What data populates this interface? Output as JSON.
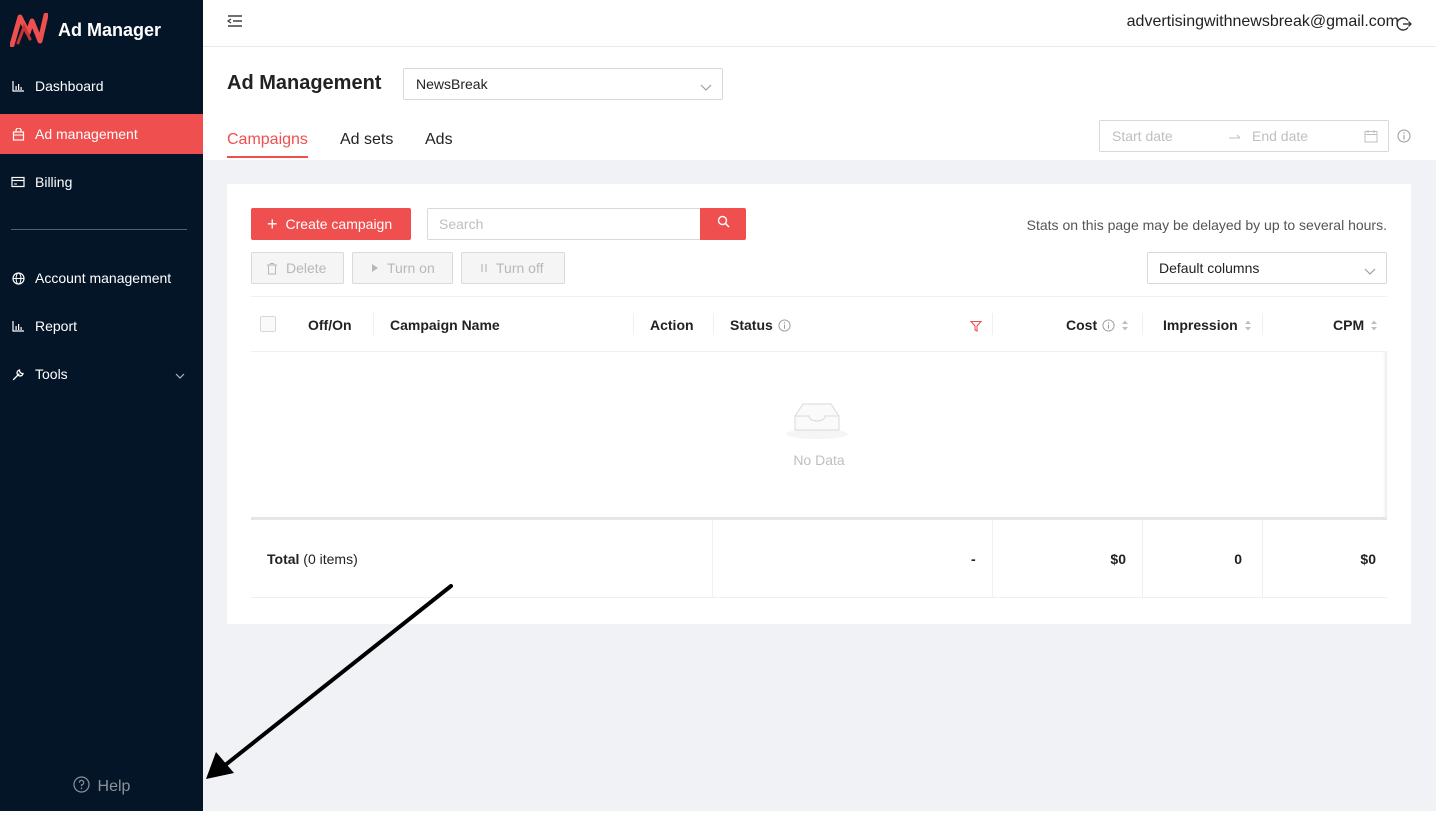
{
  "app": {
    "title": "Ad Manager"
  },
  "sidebar": {
    "items": [
      {
        "label": "Dashboard",
        "icon": "bar-chart-icon"
      },
      {
        "label": "Ad management",
        "icon": "shopping-bag-icon",
        "active": true
      },
      {
        "label": "Billing",
        "icon": "credit-card-icon"
      },
      {
        "label": "Account management",
        "icon": "globe-icon"
      },
      {
        "label": "Report",
        "icon": "bar-chart-icon"
      },
      {
        "label": "Tools",
        "icon": "wrench-icon",
        "expandable": true
      }
    ],
    "help": "Help"
  },
  "topbar": {
    "email": "advertisingwithnewsbreak@gmail.com"
  },
  "page": {
    "title": "Ad Management",
    "account_selected": "NewsBreak",
    "tabs": [
      {
        "label": "Campaigns",
        "active": true
      },
      {
        "label": "Ad sets"
      },
      {
        "label": "Ads"
      }
    ],
    "date": {
      "start_placeholder": "Start date",
      "end_placeholder": "End date"
    }
  },
  "toolbar": {
    "create_label": "Create campaign",
    "search_placeholder": "Search",
    "stats_note": "Stats on this page may be delayed by up to several hours.",
    "delete_label": "Delete",
    "turn_on_label": "Turn on",
    "turn_off_label": "Turn off",
    "columns_selected": "Default columns"
  },
  "table": {
    "columns": [
      "Off/On",
      "Campaign Name",
      "Action",
      "Status",
      "Cost",
      "Impression",
      "CPM"
    ],
    "empty_text": "No Data",
    "total_label": "Total",
    "total_count": "(0 items)",
    "totals": {
      "status": "-",
      "cost": "$0",
      "impression": "0",
      "cpm": "$0"
    }
  },
  "colors": {
    "sidebar_bg": "#041528",
    "accent": "#f04f4f",
    "page_bg": "#f0f2f5"
  }
}
